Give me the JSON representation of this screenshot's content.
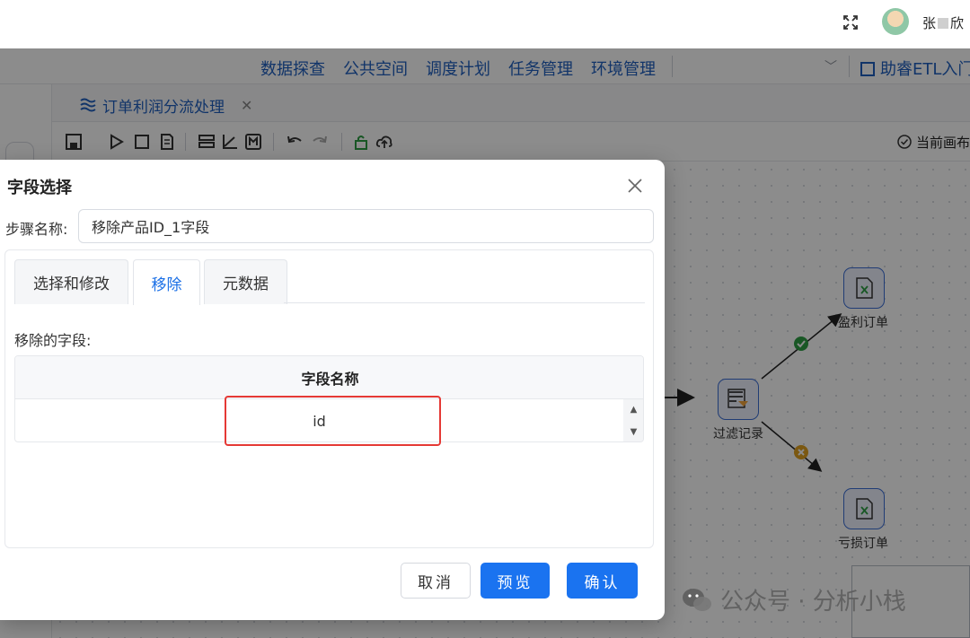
{
  "header": {
    "user_name_prefix": "张",
    "user_name_suffix": "欣"
  },
  "nav": {
    "items": [
      "数据探查",
      "公共空间",
      "调度计划",
      "任务管理",
      "环境管理"
    ],
    "etl_entry": "助睿ETL入门"
  },
  "file_tab": {
    "title": "订单利润分流处理",
    "close": "✕"
  },
  "toolbar": {
    "canvas_status": "当前画布"
  },
  "canvas": {
    "nodes": {
      "filter": "过滤记录",
      "profit": "盈利订单",
      "loss": "亏损订单"
    }
  },
  "dialog": {
    "title": "字段选择",
    "step_name_label": "步骤名称:",
    "step_name_value": "移除产品ID_1字段",
    "tabs": [
      "选择和修改",
      "移除",
      "元数据"
    ],
    "active_tab": "移除",
    "remove_fields_label": "移除的字段:",
    "table": {
      "columns": [
        "字段名称"
      ],
      "rows": [
        [
          "id"
        ]
      ]
    },
    "buttons": {
      "cancel": "取消",
      "preview": "预览",
      "confirm": "确认"
    }
  },
  "watermark": "公众号 · 分析小栈",
  "colors": {
    "primary": "#1a73f0",
    "nav_link": "#1f5fbf",
    "highlight": "#e53935",
    "success": "#2e9e44",
    "warning": "#e0a020"
  }
}
